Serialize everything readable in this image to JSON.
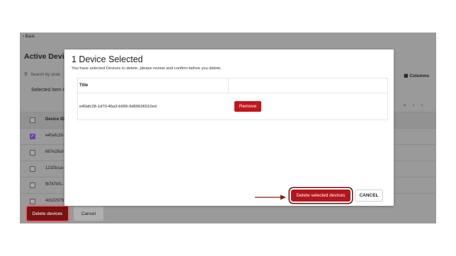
{
  "background": {
    "back_link": "‹ Back",
    "title": "Active Devic",
    "search_placeholder": "Search by unde",
    "search_icon": "search-icon",
    "columns_label": "Columns",
    "columns_icon": "columns-icon",
    "selected_label": "Selected Item C",
    "pager_glyphs": "«‹›",
    "table": {
      "header": "Device ID",
      "rows": [
        {
          "id": "e40afc28-",
          "checked": true
        },
        {
          "id": "667e26af-",
          "checked": false
        },
        {
          "id": "121f3cca-c",
          "checked": false
        },
        {
          "id": "fb787bf1-",
          "checked": false
        },
        {
          "id": "4cb22976",
          "checked": false
        }
      ]
    },
    "footer": {
      "delete_label": "Delete devices",
      "cancel_label": "Cancel"
    }
  },
  "modal": {
    "title": "1 Device Selected",
    "subtitle": "You have selected Devices to delete, please review and confirm before you delete.",
    "table": {
      "column_title": "Title",
      "rows": [
        {
          "device_id": "e40afc28-1d70-46a3-b999-9d69636510ed",
          "action": "Remove"
        }
      ]
    },
    "delete_selected_label": "Delete selected devices",
    "cancel_label": "CANCEL"
  },
  "colors": {
    "accent_red": "#c0161c",
    "dark_red": "#7a1212",
    "checkbox_purple": "#6c3fa8"
  }
}
